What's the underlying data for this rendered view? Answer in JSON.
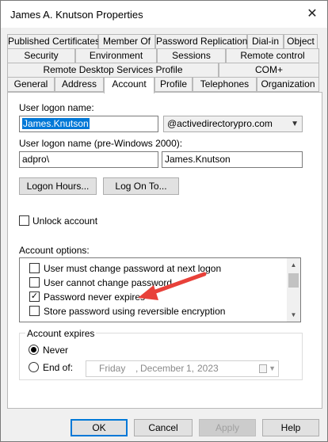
{
  "window": {
    "title": "James A. Knutson Properties",
    "close_glyph": "✕"
  },
  "tabs": {
    "row1": [
      "Published Certificates",
      "Member Of",
      "Password Replication",
      "Dial-in",
      "Object"
    ],
    "row2": [
      "Security",
      "Environment",
      "Sessions",
      "Remote control"
    ],
    "row3": [
      "Remote Desktop Services Profile",
      "COM+"
    ],
    "row4": [
      "General",
      "Address",
      "Account",
      "Profile",
      "Telephones",
      "Organization"
    ],
    "active": "Account"
  },
  "account": {
    "logon_name_label": "User logon name:",
    "logon_name_value": "James.Knutson",
    "domain_value": "@activedirectorypro.com",
    "pre2000_label": "User logon name (pre-Windows 2000):",
    "pre2000_domain": "adpro\\",
    "pre2000_value": "James.Knutson",
    "logon_hours_button": "Logon Hours...",
    "log_on_to_button": "Log On To...",
    "unlock_label": "Unlock account",
    "options_label": "Account options:",
    "options": [
      {
        "label": "User must change password at next logon",
        "checked": false
      },
      {
        "label": "User cannot change password",
        "checked": false
      },
      {
        "label": "Password never expires",
        "checked": true
      },
      {
        "label": "Store password using reversible encryption",
        "checked": false
      }
    ],
    "expires_label": "Account expires",
    "never_label": "Never",
    "endof_label": "End of:",
    "date": {
      "day": "Friday",
      "month": "December",
      "daynum": "1,",
      "year": "2023"
    }
  },
  "footer": {
    "ok": "OK",
    "cancel": "Cancel",
    "apply": "Apply",
    "help": "Help"
  },
  "colors": {
    "selection": "#0078d7",
    "arrow": "#e8413a"
  }
}
